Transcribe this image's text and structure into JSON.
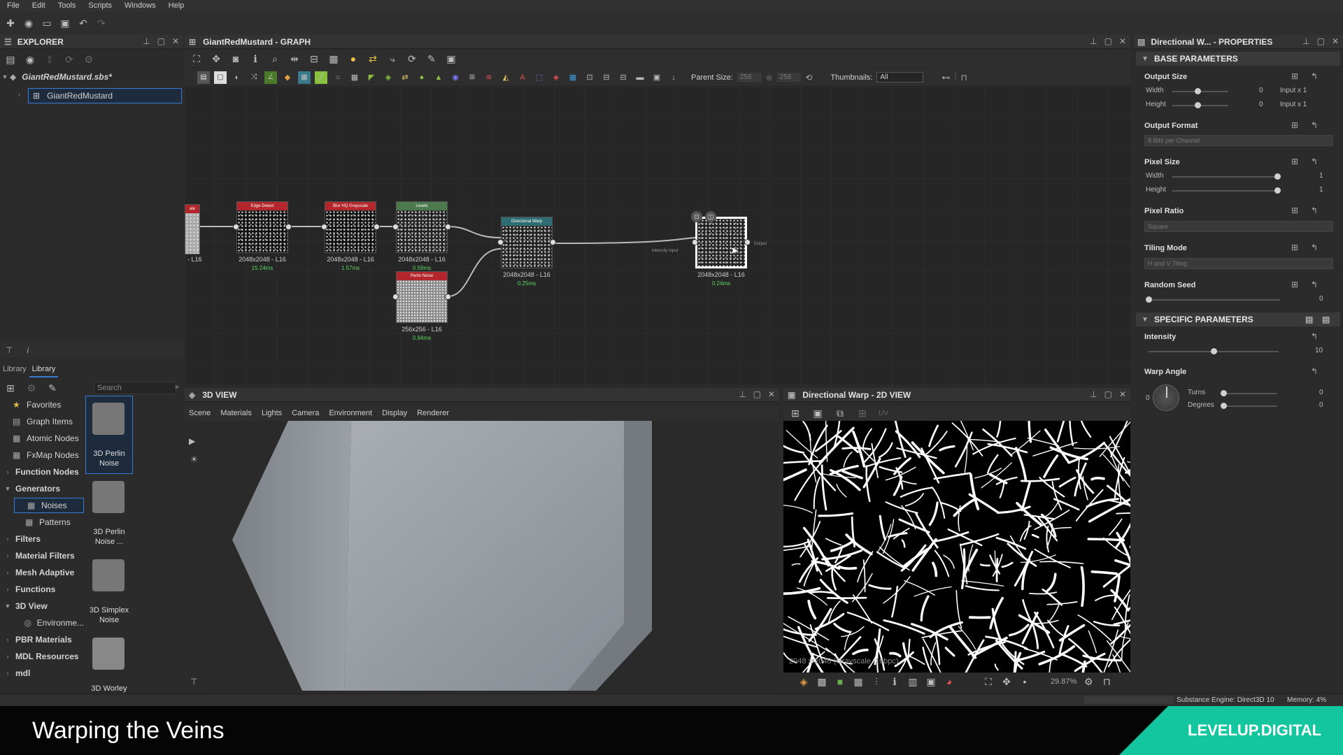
{
  "menu": [
    "File",
    "Edit",
    "Tools",
    "Scripts",
    "Windows",
    "Help"
  ],
  "explorer": {
    "title": "EXPLORER",
    "package": "GiantRedMustard.sbs*",
    "graph": "GiantRedMustard"
  },
  "graph": {
    "title": "GiantRedMustard - GRAPH",
    "parent_size_label": "Parent Size:",
    "parent_w": "256",
    "parent_h": "256",
    "thumbnails_label": "Thumbnails:",
    "thumbnails_value": "All",
    "nodes": [
      {
        "title": "Edge Detect",
        "size": "2048x2048 - L16",
        "time": "15.24ms",
        "color": "#b3262b"
      },
      {
        "title": "Blur HQ Grayscale",
        "size": "2048x2048 - L16",
        "time": "1.57ms",
        "color": "#b3262b"
      },
      {
        "title": "Levels",
        "size": "2048x2048 - L16",
        "time": "0.59ms",
        "color": "#4c7a4c"
      },
      {
        "title": "Perlin Noise",
        "size": "256x256 - L16",
        "time": "0.94ms",
        "color": "#b3262b"
      },
      {
        "title": "Directional Warp",
        "size": "2048x2048 - L16",
        "time": "0.25ms",
        "color": "#2f6d74"
      },
      {
        "title": "",
        "size": "2048x2048 - L16",
        "time": "0.24ms",
        "color": "#444"
      }
    ],
    "left_partial": {
      "title": "ale",
      "size": "- L16"
    },
    "intensity_input": "Intensity Input",
    "output_label": "Output"
  },
  "library": {
    "tab1": "Library",
    "tab2": "Library",
    "search_placeholder": "Search",
    "categories": [
      {
        "label": "Favorites",
        "bold": false
      },
      {
        "label": "Graph Items",
        "bold": false
      },
      {
        "label": "Atomic Nodes",
        "bold": false
      },
      {
        "label": "FxMap Nodes",
        "bold": false
      },
      {
        "label": "Function Nodes",
        "bold": true
      },
      {
        "label": "Generators",
        "bold": true
      },
      {
        "label": "Noises",
        "bold": false
      },
      {
        "label": "Patterns",
        "bold": false
      },
      {
        "label": "Filters",
        "bold": true
      },
      {
        "label": "Material Filters",
        "bold": true
      },
      {
        "label": "Mesh Adaptive",
        "bold": true
      },
      {
        "label": "Functions",
        "bold": true
      },
      {
        "label": "3D View",
        "bold": true
      },
      {
        "label": "Environme...",
        "bold": false
      },
      {
        "label": "PBR Materials",
        "bold": true
      },
      {
        "label": "MDL Resources",
        "bold": true
      },
      {
        "label": "mdl",
        "bold": true
      }
    ],
    "items": [
      "3D Perlin Noise",
      "3D Perlin Noise ...",
      "3D Simplex Noise",
      "3D Worley"
    ]
  },
  "view3d": {
    "title": "3D VIEW",
    "menu": [
      "Scene",
      "Materials",
      "Lights",
      "Camera",
      "Environment",
      "Display",
      "Renderer"
    ]
  },
  "view2d": {
    "title": "Directional Warp - 2D VIEW",
    "uv": "UV",
    "info": "2048 x 2048 (Grayscale, 16bpc)",
    "zoom": "29.87%"
  },
  "properties": {
    "title": "Directional W... - PROPERTIES",
    "base_section": "BASE PARAMETERS",
    "specific_section": "SPECIFIC PARAMETERS",
    "output_size": {
      "label": "Output Size",
      "width_label": "Width",
      "height_label": "Height",
      "width_val": "0",
      "height_val": "0",
      "width_mode": "Input x 1",
      "height_mode": "Input x 1"
    },
    "output_format": {
      "label": "Output Format",
      "value": "8 Bits per Channel"
    },
    "pixel_size": {
      "label": "Pixel Size",
      "width_label": "Width",
      "height_label": "Height",
      "width_val": "1",
      "height_val": "1"
    },
    "pixel_ratio": {
      "label": "Pixel Ratio",
      "value": "Square"
    },
    "tiling_mode": {
      "label": "Tiling Mode",
      "value": "H and V Tiling"
    },
    "random_seed": {
      "label": "Random Seed",
      "value": "0"
    },
    "intensity": {
      "label": "Intensity",
      "value": "10",
      "fraction": 0.5
    },
    "warp_angle": {
      "label": "Warp Angle",
      "turns_label": "Turns",
      "degrees_label": "Degrees",
      "turns_val": "0",
      "degrees_val": "0",
      "dial_zero": "0"
    }
  },
  "statusbar": {
    "engine": "Substance Engine: Direct3D 10",
    "memory": "Memory: 4%"
  },
  "banner": {
    "title": "Warping the Veins",
    "brand": "LEVELUP.DIGITAL",
    "brand_color": "#13c6a0"
  }
}
